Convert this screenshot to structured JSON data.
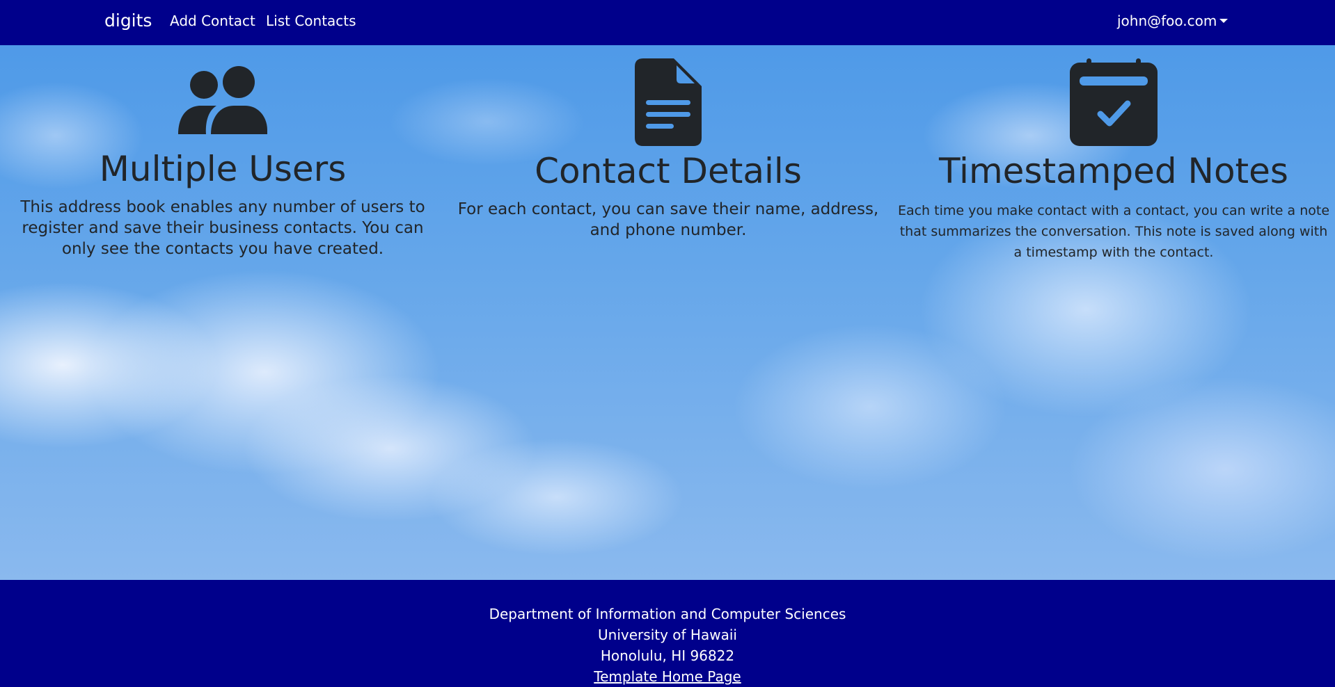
{
  "navbar": {
    "brand": "digits",
    "links": [
      {
        "label": "Add Contact"
      },
      {
        "label": "List Contacts"
      }
    ],
    "user": "john@foo.com",
    "background": "#00008b"
  },
  "features": [
    {
      "icon": "users-icon",
      "title": "Multiple Users",
      "description": "This address book enables any number of users to register and save their business contacts. You can only see the contacts you have created."
    },
    {
      "icon": "document-icon",
      "title": "Contact Details",
      "description": "For each contact, you can save their name, address, and phone number."
    },
    {
      "icon": "calendar-check-icon",
      "title": "Timestamped Notes",
      "description": "Each time you make contact with a contact, you can write a note that summarizes the conversation. This note is saved along with a timestamp with the contact."
    }
  ],
  "footer": {
    "lines": [
      "Department of Information and Computer Sciences",
      "University of Hawaii",
      "Honolulu, HI 96822"
    ],
    "link_label": "Template Home Page"
  }
}
